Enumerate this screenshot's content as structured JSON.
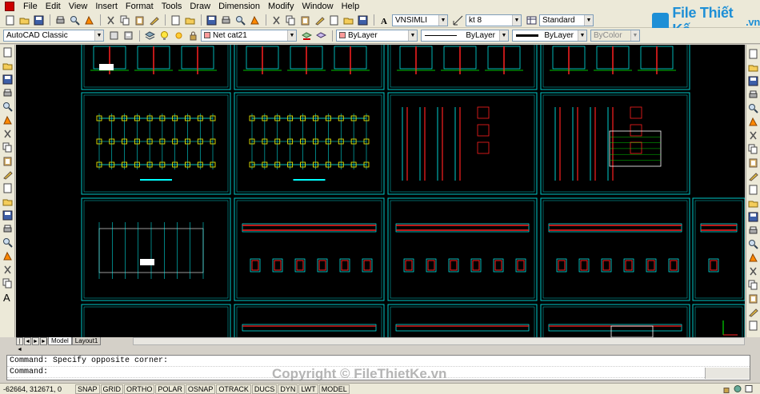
{
  "menus": [
    "File",
    "Edit",
    "View",
    "Insert",
    "Format",
    "Tools",
    "Draw",
    "Dimension",
    "Modify",
    "Window",
    "Help"
  ],
  "styles_toolbar": {
    "text_style": "VNSIMLI",
    "dim_style": "kt 8",
    "table_style": "Standard"
  },
  "workspace": "AutoCAD Classic",
  "layer": "Net cat21",
  "properties": {
    "color": "ByLayer",
    "linetype": "ByLayer",
    "lineweight": "ByLayer",
    "plotstyle": "ByColor"
  },
  "logo": {
    "text": "File Thiết Kế",
    "suffix": ".vn",
    "color": "#1e8fd6"
  },
  "tabs": [
    "Model",
    "Layout1"
  ],
  "command": {
    "history": "Command: Specify opposite corner:",
    "prompt": "Command:"
  },
  "watermark": "Copyright © FileThietKe.vn",
  "status": {
    "coords": "-62664, 312671, 0",
    "buttons": [
      "SNAP",
      "GRID",
      "ORTHO",
      "POLAR",
      "OSNAP",
      "OTRACK",
      "DUCS",
      "DYN",
      "LWT",
      "MODEL"
    ]
  },
  "colors": {
    "canvas": "#000000",
    "frame": "#00c8c8",
    "drawing_lines": "#00ffff",
    "red_detail": "#ff2020",
    "green_detail": "#00ff00",
    "yellow_detail": "#ffff00",
    "white_detail": "#ffffff"
  },
  "icons": {
    "top_toolbar": [
      "new-icon",
      "open-icon",
      "save-icon",
      "print-icon",
      "preview-icon",
      "publish-icon",
      "cut-icon",
      "copy-icon",
      "paste-icon",
      "match-icon",
      "undo-icon",
      "redo-icon",
      "pan-icon",
      "zoom-realtime-icon",
      "zoom-window-icon",
      "zoom-previous-icon",
      "properties-icon",
      "design-center-icon",
      "tool-palette-icon",
      "sheet-set-icon",
      "markup-icon",
      "calculator-icon",
      "help-icon"
    ],
    "draw_toolbar": [
      "line-icon",
      "construction-line-icon",
      "polyline-icon",
      "polygon-icon",
      "rectangle-icon",
      "arc-icon",
      "circle-icon",
      "revision-cloud-icon",
      "spline-icon",
      "ellipse-icon",
      "ellipse-arc-icon",
      "insert-block-icon",
      "make-block-icon",
      "point-icon",
      "hatch-icon",
      "gradient-icon",
      "region-icon",
      "table-icon",
      "multiline-text-icon"
    ],
    "modify_toolbar": [
      "erase-icon",
      "copy-object-icon",
      "mirror-icon",
      "offset-icon",
      "array-icon",
      "move-icon",
      "rotate-icon",
      "scale-icon",
      "stretch-icon",
      "trim-icon",
      "extend-icon",
      "break-at-point-icon",
      "break-icon",
      "join-icon",
      "chamfer-icon",
      "fillet-icon",
      "explode-icon"
    ],
    "draw_order_toolbar": [
      "bring-to-front-icon",
      "send-to-back-icon",
      "bring-above-icon",
      "send-under-icon"
    ]
  }
}
